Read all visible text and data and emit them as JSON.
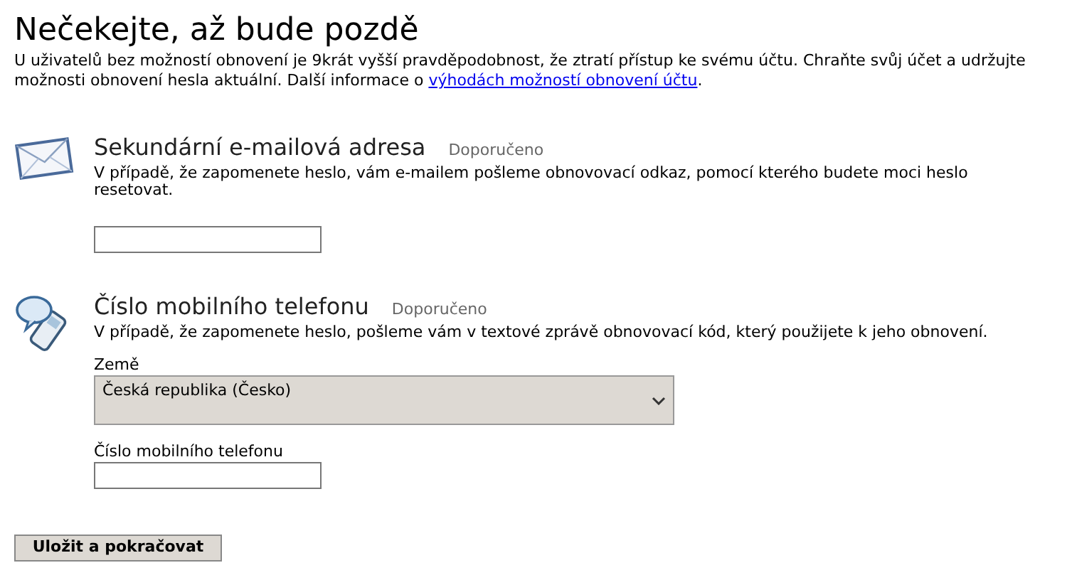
{
  "heading": "Nečekejte, až bude pozdě",
  "intro": {
    "text": "U uživatelů bez možností obnovení je 9krát vyšší pravděpodobnost, že ztratí přístup ke svému účtu. Chraňte svůj účet a udržujte možnosti obnovení hesla aktuální. Další informace o ",
    "link": "výhodách možností obnovení účtu",
    "after": "."
  },
  "sections": [
    {
      "kind": "email",
      "title": "Sekundární e-mailová adresa",
      "badge": "Doporučeno",
      "description": "V případě, že zapomenete heslo, vám e-mailem pošleme obnovovací odkaz, pomocí kterého budete moci heslo resetovat."
    },
    {
      "kind": "phone",
      "title": "Číslo mobilního telefonu",
      "badge": "Doporučeno",
      "description": "V případě, že zapomenete heslo, pošleme vám v textové zprávě obnovovací kód, který použijete k jeho obnovení.",
      "country_label": "Země",
      "country_value": "Česká republika (Česko)",
      "phone_label": "Číslo mobilního telefonu"
    }
  ],
  "button": "Uložit a pokračovat"
}
